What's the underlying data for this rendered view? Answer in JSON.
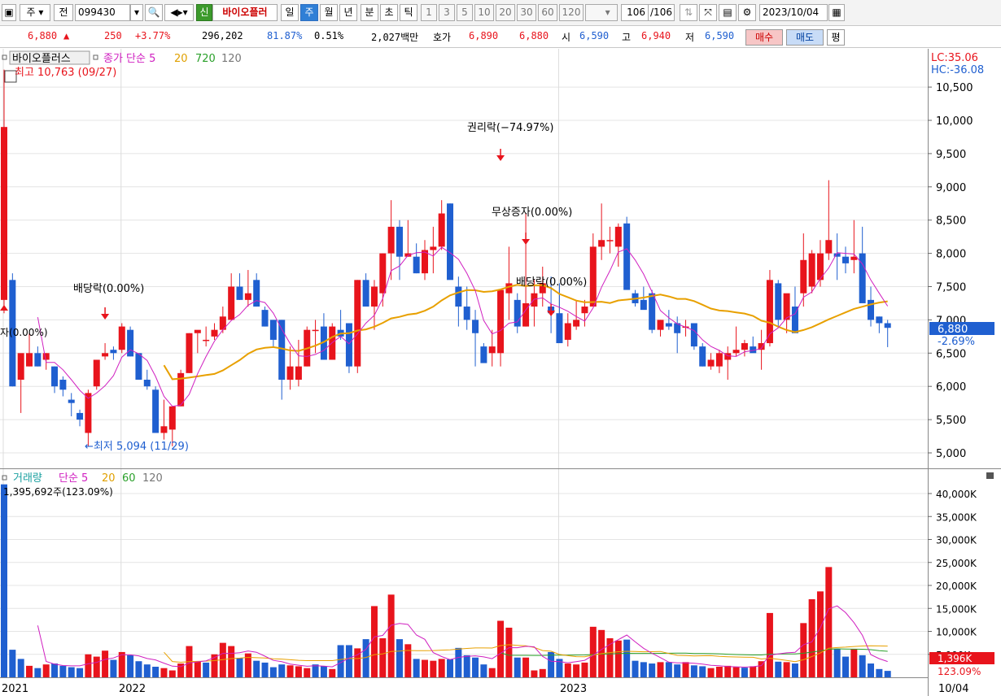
{
  "toolbar": {
    "market": "주",
    "scope": "전",
    "stock_code": "099430",
    "credit_tag": "신",
    "stock_name": "바이오플러",
    "periods": [
      "일",
      "주",
      "월",
      "년",
      "분",
      "초",
      "틱"
    ],
    "selected_period": "주",
    "minute_units": [
      "1",
      "3",
      "5",
      "10",
      "20",
      "30",
      "60",
      "120"
    ],
    "count": "106",
    "count_total": "/106",
    "date": "2023/10/04"
  },
  "quote": {
    "price": "6,880",
    "change_arrow": "▲",
    "change": "250",
    "change_pct": "+3.77%",
    "volume": "296,202",
    "ratio1": "81.87%",
    "ratio2": "0.51%",
    "amount": "2,027백만",
    "ask_label": "호가",
    "ask": "6,890",
    "bid": "6,880",
    "open_label": "시",
    "open": "6,590",
    "high_label": "고",
    "high": "6,940",
    "low_label": "저",
    "low": "6,590",
    "buy_label": "매수",
    "sell_label": "매도",
    "avg_label": "평"
  },
  "price_legend": {
    "name": "바이오플러스",
    "ma_label": "종가 단순 5",
    "ma20": "20",
    "ma720": "720",
    "ma120": "120"
  },
  "volume_legend": {
    "name": "거래량",
    "ma_label": "단순 5",
    "ma20": "20",
    "ma60": "60",
    "ma120": "120",
    "first_value": "1,395,692주(123.09%)"
  },
  "annotations": {
    "high": "최고 10,763 (09/27)",
    "low": "←최저 5,094 (11/29)",
    "dividend1": "배당락(0.00%)",
    "rights": "권리락(−74.97%)",
    "bonus": "무상증자(0.00%)",
    "dividend2": "배당락(0.00%)",
    "left_cut": "자(0.00%)"
  },
  "right_axis": {
    "lc": "LC:35.06",
    "hc": "HC:-36.08",
    "price_tag": "6,880",
    "price_pct": "-2.69%",
    "vol_tag": "1,396K",
    "vol_pct": "123.09%"
  },
  "chart_data": [
    {
      "type": "candlestick",
      "title": "바이오플러스",
      "ylim": [
        4800,
        11000
      ],
      "yticks": [
        "10,500",
        "10,000",
        "9,500",
        "9,000",
        "8,500",
        "8,000",
        "7,500",
        "7,000",
        "6,500",
        "6,000",
        "5,500",
        "5,000"
      ],
      "ytick_values": [
        10500,
        10000,
        9500,
        9000,
        8500,
        8000,
        7500,
        7000,
        6500,
        6000,
        5500,
        5000
      ],
      "x_labels": [
        "2021",
        "2022",
        "2023",
        "10/04"
      ],
      "candles_ohlc": [
        [
          7300,
          10763,
          7100,
          9900
        ],
        [
          7600,
          7700,
          6000,
          6000
        ],
        [
          6100,
          6100,
          5600,
          6500
        ],
        [
          6300,
          6800,
          6300,
          6500
        ],
        [
          6500,
          6600,
          6300,
          6300
        ],
        [
          6400,
          6500,
          6250,
          6500
        ],
        [
          6300,
          6300,
          5900,
          6000
        ],
        [
          6100,
          6150,
          5850,
          5950
        ],
        [
          5800,
          5900,
          5550,
          5750
        ],
        [
          5600,
          5650,
          5400,
          5500
        ],
        [
          5300,
          5950,
          5094,
          5900
        ],
        [
          6000,
          6400,
          5950,
          6400
        ],
        [
          6450,
          6650,
          6400,
          6500
        ],
        [
          6550,
          6600,
          6400,
          6500
        ],
        [
          6550,
          6950,
          6500,
          6900
        ],
        [
          6850,
          6900,
          6450,
          6450
        ],
        [
          6500,
          6500,
          6150,
          6100
        ],
        [
          6100,
          6250,
          5950,
          6000
        ],
        [
          5950,
          6000,
          5500,
          5300
        ],
        [
          5300,
          5800,
          5200,
          5400
        ],
        [
          5350,
          5700,
          5100,
          5700
        ],
        [
          5700,
          6250,
          5700,
          6200
        ],
        [
          6200,
          6800,
          6200,
          6800
        ],
        [
          6800,
          6800,
          6500,
          6850
        ],
        [
          6700,
          6900,
          6600,
          6700
        ],
        [
          6750,
          6950,
          6700,
          6850
        ],
        [
          6850,
          7200,
          6800,
          7050
        ],
        [
          7000,
          7700,
          7000,
          7500
        ],
        [
          7500,
          7700,
          7300,
          7300
        ],
        [
          7300,
          7750,
          7200,
          7400
        ],
        [
          7600,
          7700,
          7200,
          7200
        ],
        [
          7150,
          7200,
          6900,
          6900
        ],
        [
          7000,
          7000,
          6600,
          6700
        ],
        [
          7000,
          7000,
          5800,
          6100
        ],
        [
          6100,
          6600,
          5950,
          6300
        ],
        [
          6100,
          6700,
          6000,
          6300
        ],
        [
          6300,
          6900,
          6300,
          6850
        ],
        [
          6850,
          7000,
          6500,
          6850
        ],
        [
          6900,
          7100,
          6800,
          6400
        ],
        [
          6400,
          6950,
          6400,
          6900
        ],
        [
          6850,
          7150,
          6700,
          6750
        ],
        [
          6950,
          6950,
          6200,
          6300
        ],
        [
          6300,
          7600,
          6200,
          7600
        ],
        [
          7600,
          7700,
          7300,
          7200
        ],
        [
          7200,
          7600,
          6850,
          7500
        ],
        [
          7400,
          8000,
          7200,
          8000
        ],
        [
          8000,
          8800,
          7600,
          8400
        ],
        [
          8400,
          8500,
          7600,
          7950
        ],
        [
          7950,
          8500,
          7950,
          8000
        ],
        [
          7950,
          8150,
          7700,
          7700
        ],
        [
          7700,
          8200,
          7600,
          8050
        ],
        [
          8050,
          8400,
          7700,
          8100
        ],
        [
          8100,
          8800,
          8050,
          8600
        ],
        [
          8750,
          8750,
          7800,
          7600
        ],
        [
          7500,
          7650,
          6900,
          7200
        ],
        [
          7200,
          7500,
          6850,
          7000
        ],
        [
          7000,
          7150,
          6300,
          6800
        ],
        [
          6600,
          6650,
          6400,
          6350
        ],
        [
          6500,
          6850,
          6300,
          6600
        ],
        [
          6500,
          7400,
          6300,
          7450
        ],
        [
          7400,
          8100,
          7000,
          7550
        ],
        [
          7300,
          7400,
          6800,
          6900
        ],
        [
          6900,
          8600,
          6900,
          7250
        ],
        [
          7200,
          7600,
          6900,
          7400
        ],
        [
          7400,
          7800,
          7200,
          7550
        ],
        [
          7200,
          7650,
          6800,
          7100
        ],
        [
          7100,
          7550,
          6700,
          6650
        ],
        [
          6700,
          7100,
          6600,
          6950
        ],
        [
          6900,
          7300,
          6850,
          7000
        ],
        [
          7100,
          7300,
          6900,
          7200
        ],
        [
          7200,
          8300,
          7200,
          8100
        ],
        [
          8100,
          8750,
          7900,
          8200
        ],
        [
          8200,
          8400,
          8000,
          8200
        ],
        [
          8100,
          8450,
          7800,
          8400
        ],
        [
          8450,
          8550,
          7500,
          7450
        ],
        [
          7400,
          7450,
          7200,
          7250
        ],
        [
          7300,
          7500,
          7200,
          7150
        ],
        [
          7400,
          7450,
          6800,
          6850
        ],
        [
          6850,
          7000,
          6750,
          7000
        ],
        [
          6950,
          7150,
          6850,
          6900
        ],
        [
          6950,
          7050,
          6500,
          6800
        ],
        [
          6900,
          7000,
          6750,
          6900
        ],
        [
          6950,
          6950,
          6550,
          6600
        ],
        [
          6600,
          6650,
          6300,
          6300
        ],
        [
          6300,
          6500,
          6250,
          6400
        ],
        [
          6300,
          6550,
          6200,
          6500
        ],
        [
          6400,
          6600,
          6100,
          6500
        ],
        [
          6500,
          6900,
          6450,
          6550
        ],
        [
          6550,
          6700,
          6450,
          6650
        ],
        [
          6600,
          6750,
          6550,
          6500
        ],
        [
          6550,
          6850,
          6250,
          6650
        ],
        [
          6650,
          7750,
          6600,
          7600
        ],
        [
          7550,
          7600,
          6900,
          7000
        ],
        [
          7000,
          7200,
          6800,
          7400
        ],
        [
          7200,
          7500,
          6800,
          6800
        ],
        [
          7400,
          8300,
          7200,
          7900
        ],
        [
          7500,
          8050,
          7400,
          8000
        ],
        [
          7600,
          8200,
          7500,
          8000
        ],
        [
          8000,
          9100,
          7900,
          8200
        ],
        [
          8000,
          8300,
          7600,
          7950
        ],
        [
          7950,
          8100,
          7700,
          7850
        ],
        [
          7900,
          8500,
          7700,
          7950
        ],
        [
          8000,
          8400,
          7500,
          7250
        ],
        [
          7300,
          7500,
          6900,
          7000
        ],
        [
          7050,
          7050,
          6800,
          6950
        ],
        [
          6950,
          7000,
          6590,
          6880
        ]
      ],
      "events": [
        {
          "index": 12,
          "label": "배당락(0.00%)"
        },
        {
          "index": 59,
          "label": "권리락(−74.97%)"
        },
        {
          "index": 62,
          "label": "무상증자(0.00%)"
        },
        {
          "index": 65,
          "label": "배당락(0.00%)"
        }
      ]
    },
    {
      "type": "bar",
      "title": "거래량",
      "ylim": [
        0,
        42000
      ],
      "unit": "K",
      "yticks": [
        "40,000K",
        "35,000K",
        "30,000K",
        "25,000K",
        "20,000K",
        "15,000K",
        "10,000K",
        "5,000K"
      ],
      "ytick_values": [
        40000,
        35000,
        30000,
        25000,
        20000,
        15000,
        10000,
        5000
      ],
      "values": [
        42000,
        6000,
        4000,
        2500,
        2000,
        2800,
        3000,
        2500,
        2200,
        2000,
        5000,
        4500,
        5800,
        3800,
        5500,
        4800,
        3500,
        2800,
        2300,
        2000,
        1500,
        3000,
        6800,
        3500,
        3200,
        5000,
        7500,
        6800,
        4200,
        5200,
        3600,
        3200,
        2200,
        2800,
        2600,
        2400,
        2000,
        2800,
        2400,
        1800,
        7000,
        7000,
        6300,
        8300,
        15500,
        8500,
        18000,
        8300,
        7200,
        4000,
        3800,
        3600,
        4000,
        3900,
        6400,
        4800,
        4300,
        2800,
        2000,
        12300,
        10800,
        4300,
        4300,
        1500,
        1800,
        5500,
        4000,
        3000,
        2800,
        3200,
        11000,
        10300,
        8500,
        8000,
        8200,
        3600,
        3300,
        3000,
        3300,
        3300,
        2800,
        3300,
        2600,
        2400,
        2000,
        2300,
        2500,
        2200,
        2100,
        2400,
        3500,
        14000,
        3400,
        3300,
        3000,
        11800,
        17000,
        18700,
        24000,
        6200,
        4500,
        6200,
        4800,
        3000,
        1800,
        1396
      ],
      "colors_up": [
        0,
        0,
        0,
        1,
        0,
        1,
        0,
        0,
        0,
        0,
        1,
        1,
        1,
        0,
        1,
        0,
        0,
        0,
        0,
        1,
        1,
        1,
        1,
        1,
        0,
        1,
        1,
        1,
        0,
        1,
        0,
        0,
        0,
        0,
        1,
        1,
        1,
        0,
        0,
        1,
        0,
        0,
        1,
        0,
        1,
        1,
        1,
        0,
        1,
        0,
        1,
        1,
        1,
        0,
        0,
        0,
        0,
        0,
        1,
        1,
        1,
        0,
        1,
        1,
        1,
        0,
        0,
        1,
        1,
        1,
        1,
        1,
        1,
        1,
        0,
        0,
        0,
        0,
        1,
        0,
        0,
        1,
        0,
        0,
        1,
        1,
        1,
        1,
        0,
        1,
        1,
        1,
        0,
        1,
        0,
        1,
        1,
        1,
        1,
        0,
        0,
        1,
        0,
        0,
        0,
        0
      ]
    }
  ]
}
